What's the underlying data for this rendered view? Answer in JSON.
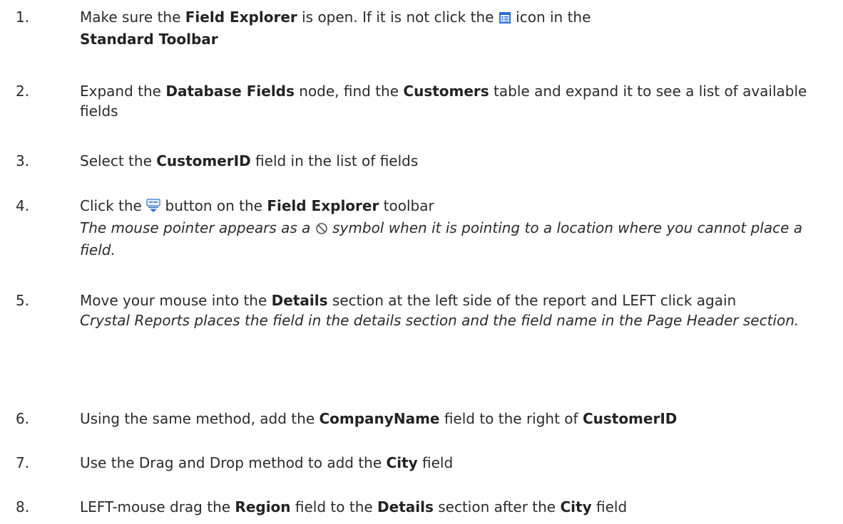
{
  "steps": [
    {
      "number": "1.",
      "parts": [
        "Make sure the ",
        "Field Explorer",
        " is open. If it is not click the ",
        " icon in the ",
        "Standard Toolbar"
      ],
      "icon": "field-explorer-icon"
    },
    {
      "number": "2.",
      "parts": [
        "Expand the ",
        "Database Fields",
        " node, find the ",
        "Customers",
        " table and expand it to see a list of available fields"
      ]
    },
    {
      "number": "3.",
      "parts": [
        "Select the ",
        "CustomerID",
        " field in the list of fields"
      ]
    },
    {
      "number": "4.",
      "parts": [
        "Click the ",
        " button on the ",
        "Field Explorer",
        " toolbar"
      ],
      "icon": "insert-to-report-icon",
      "note_parts": [
        "The mouse pointer appears as a ",
        " symbol when it is pointing to a location where you cannot place a field."
      ],
      "note_icon": "no-symbol-icon"
    },
    {
      "number": "5.",
      "parts": [
        "Move your mouse into the ",
        "Details",
        " section at the left side of the report and LEFT click again"
      ],
      "note": "Crystal Reports places the field in the details section and the field name in the Page Header section."
    },
    {
      "number": "6.",
      "parts": [
        "Using the same method, add the ",
        "CompanyName",
        " field to the right of ",
        "CustomerID"
      ]
    },
    {
      "number": "7.",
      "parts": [
        "Use the Drag and Drop method to add the ",
        "City",
        " field"
      ]
    },
    {
      "number": "8.",
      "parts": [
        "LEFT-mouse drag the ",
        "Region",
        " field to the ",
        "Details",
        " section after the ",
        "City",
        " field"
      ]
    }
  ]
}
